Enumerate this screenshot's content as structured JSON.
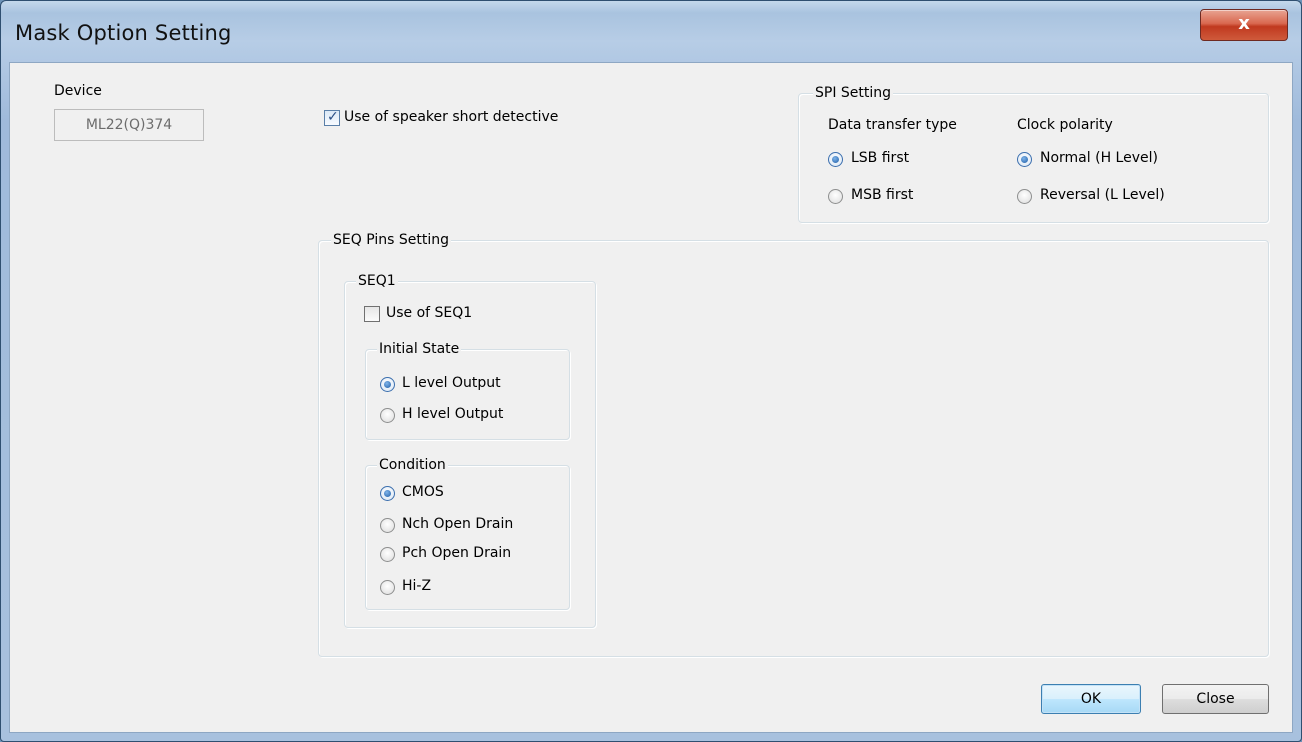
{
  "window": {
    "title": "Mask Option Setting",
    "close_glyph": "x"
  },
  "device": {
    "label": "Device",
    "value": "ML22(Q)374"
  },
  "speaker_check": {
    "label": "Use of speaker short detective",
    "checked": true
  },
  "spi": {
    "title": "SPI Setting",
    "data_transfer": {
      "label": "Data transfer type",
      "options": [
        "LSB first",
        "MSB first"
      ],
      "selected": "LSB first"
    },
    "clock_polarity": {
      "label": "Clock polarity",
      "options": [
        "Normal (H Level)",
        "Reversal (L Level)"
      ],
      "selected": "Normal (H Level)"
    }
  },
  "seq_pins": {
    "title": "SEQ Pins Setting",
    "seq1": {
      "title": "SEQ1",
      "use_label": "Use of SEQ1",
      "use_checked": false,
      "initial_state": {
        "title": "Initial State",
        "options": [
          "L level Output",
          "H level Output"
        ],
        "selected": "L level Output"
      },
      "condition": {
        "title": "Condition",
        "options": [
          "CMOS",
          "Nch Open Drain",
          "Pch Open Drain",
          "Hi-Z"
        ],
        "selected": "CMOS"
      }
    }
  },
  "buttons": {
    "ok": "OK",
    "close": "Close"
  }
}
